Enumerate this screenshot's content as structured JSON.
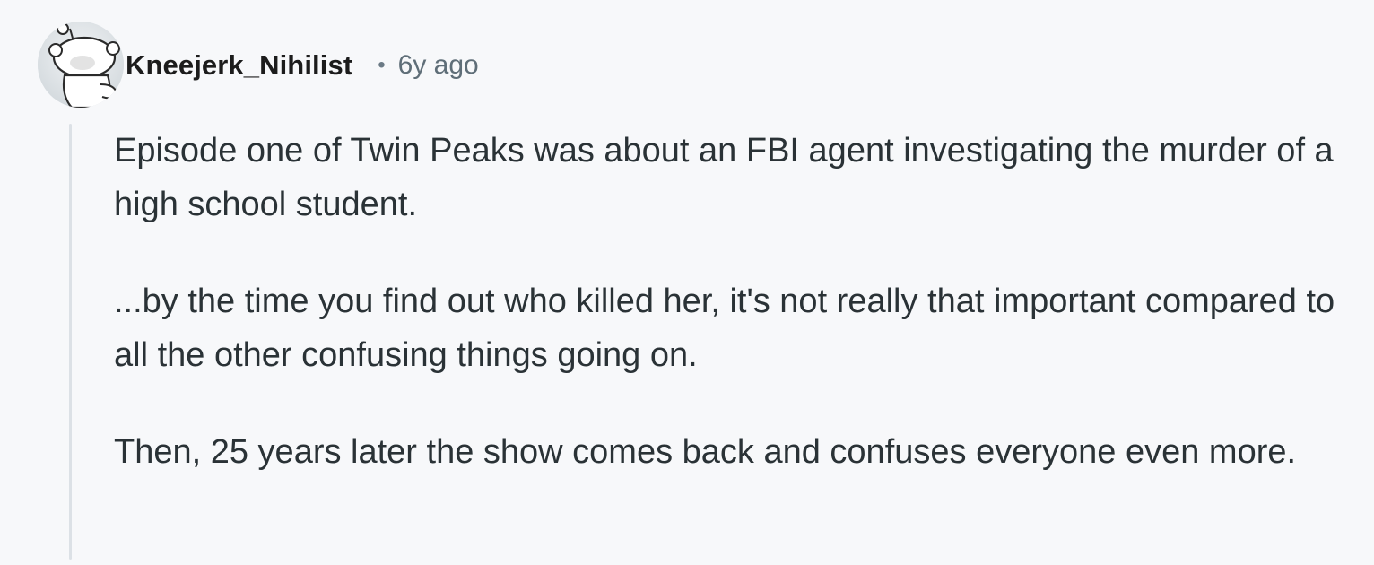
{
  "comment": {
    "author": "Kneejerk_Nihilist",
    "separator": "•",
    "timestamp": "6y ago",
    "avatar_icon": "reddit-snoo-avatar-icon",
    "paragraphs": [
      "Episode one of Twin Peaks was about an FBI agent investigating the murder of a high school student.",
      "...by the time you find out who killed her, it's not really that important compared to all the other confusing things going on.",
      "Then, 25 years later the show comes back and confuses everyone even more."
    ]
  },
  "colors": {
    "background": "#f7f8fa",
    "text": "#2a3236",
    "author": "#1c1c1c",
    "meta": "#5f6e78",
    "thread_line": "#dce1e6"
  }
}
